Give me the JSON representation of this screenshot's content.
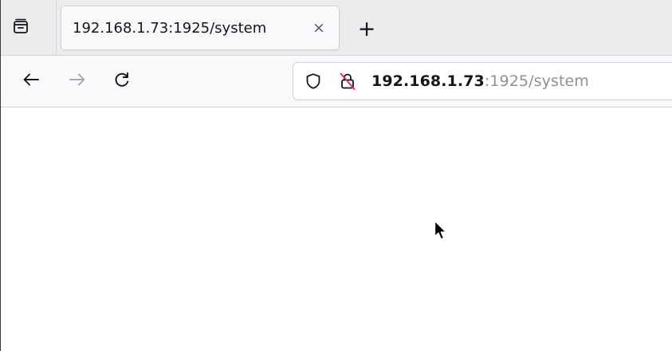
{
  "tab": {
    "title": "192.168.1.73:1925/system",
    "close_glyph": "×"
  },
  "new_tab_glyph": "+",
  "icons": {
    "tab_list": "tab-list-icon",
    "close": "close-icon",
    "new_tab": "plus-icon",
    "back": "back-arrow-icon",
    "forward": "forward-arrow-icon",
    "reload": "reload-icon",
    "tracking_protection": "shield-icon",
    "insecure_lock": "insecure-lock-icon",
    "cursor": "mouse-pointer-icon"
  },
  "urlbar": {
    "host": "192.168.1.73",
    "rest": ":1925/system"
  },
  "nav": {
    "forward_enabled": false
  },
  "colors": {
    "tabstrip_bg": "#ececee",
    "toolbar_bg": "#f9f9fb",
    "insecure_slash": "#e22850",
    "url_host": "#15141a",
    "url_rest": "#8f8f9d"
  }
}
